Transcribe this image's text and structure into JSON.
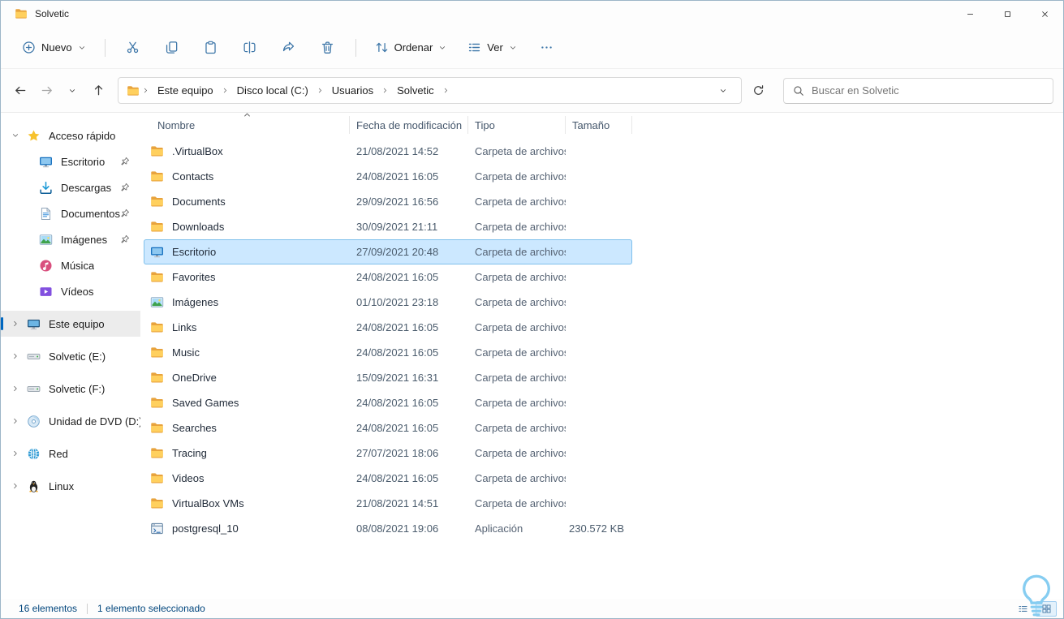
{
  "window": {
    "title": "Solvetic"
  },
  "theme": {
    "accent": "#0067c0",
    "selection_bg": "#cce8ff",
    "selection_border": "#7fc0ec",
    "status_text": "#00457c",
    "folder_color": "#ffd05e",
    "toolbar_icon_color": "#3d76a8"
  },
  "toolbar": {
    "new_label": "Nuevo",
    "sort_label": "Ordenar",
    "view_label": "Ver"
  },
  "navigation": {
    "breadcrumbs": [
      {
        "label": "Este equipo"
      },
      {
        "label": "Disco local (C:)"
      },
      {
        "label": "Usuarios"
      },
      {
        "label": "Solvetic"
      }
    ],
    "search_placeholder": "Buscar en Solvetic"
  },
  "sidebar": {
    "quick_access": {
      "label": "Acceso rápido",
      "icon": "star",
      "items": [
        {
          "label": "Escritorio",
          "icon": "desktop",
          "pinned": true
        },
        {
          "label": "Descargas",
          "icon": "download",
          "pinned": true
        },
        {
          "label": "Documentos",
          "icon": "document",
          "pinned": true
        },
        {
          "label": "Imágenes",
          "icon": "picture",
          "pinned": true
        },
        {
          "label": "Música",
          "icon": "music",
          "pinned": false
        },
        {
          "label": "Vídeos",
          "icon": "video",
          "pinned": false
        }
      ]
    },
    "tree": [
      {
        "label": "Este equipo",
        "icon": "computer",
        "selected": true
      },
      {
        "label": "Solvetic (E:)",
        "icon": "drive",
        "selected": false
      },
      {
        "label": "Solvetic (F:)",
        "icon": "drive",
        "selected": false
      },
      {
        "label": "Unidad de DVD (D:)",
        "icon": "dvd",
        "selected": false
      },
      {
        "label": "Red",
        "icon": "network",
        "selected": false
      },
      {
        "label": "Linux",
        "icon": "linux",
        "selected": false
      }
    ]
  },
  "file_list": {
    "columns": [
      {
        "label": "Nombre",
        "sorted": "asc"
      },
      {
        "label": "Fecha de modificación"
      },
      {
        "label": "Tipo"
      },
      {
        "label": "Tamaño"
      }
    ],
    "rows": [
      {
        "name": ".VirtualBox",
        "modified": "21/08/2021 14:52",
        "type": "Carpeta de archivos",
        "size": "",
        "icon": "folder",
        "selected": false
      },
      {
        "name": "Contacts",
        "modified": "24/08/2021 16:05",
        "type": "Carpeta de archivos",
        "size": "",
        "icon": "folder",
        "selected": false
      },
      {
        "name": "Documents",
        "modified": "29/09/2021 16:56",
        "type": "Carpeta de archivos",
        "size": "",
        "icon": "folder",
        "selected": false
      },
      {
        "name": "Downloads",
        "modified": "30/09/2021 21:11",
        "type": "Carpeta de archivos",
        "size": "",
        "icon": "folder",
        "selected": false
      },
      {
        "name": "Escritorio",
        "modified": "27/09/2021 20:48",
        "type": "Carpeta de archivos",
        "size": "",
        "icon": "desktop",
        "selected": true
      },
      {
        "name": "Favorites",
        "modified": "24/08/2021 16:05",
        "type": "Carpeta de archivos",
        "size": "",
        "icon": "folder",
        "selected": false
      },
      {
        "name": "Imágenes",
        "modified": "01/10/2021 23:18",
        "type": "Carpeta de archivos",
        "size": "",
        "icon": "picture",
        "selected": false
      },
      {
        "name": "Links",
        "modified": "24/08/2021 16:05",
        "type": "Carpeta de archivos",
        "size": "",
        "icon": "folder",
        "selected": false
      },
      {
        "name": "Music",
        "modified": "24/08/2021 16:05",
        "type": "Carpeta de archivos",
        "size": "",
        "icon": "folder",
        "selected": false
      },
      {
        "name": "OneDrive",
        "modified": "15/09/2021 16:31",
        "type": "Carpeta de archivos",
        "size": "",
        "icon": "folder",
        "selected": false
      },
      {
        "name": "Saved Games",
        "modified": "24/08/2021 16:05",
        "type": "Carpeta de archivos",
        "size": "",
        "icon": "folder",
        "selected": false
      },
      {
        "name": "Searches",
        "modified": "24/08/2021 16:05",
        "type": "Carpeta de archivos",
        "size": "",
        "icon": "folder",
        "selected": false
      },
      {
        "name": "Tracing",
        "modified": "27/07/2021 18:06",
        "type": "Carpeta de archivos",
        "size": "",
        "icon": "folder",
        "selected": false
      },
      {
        "name": "Videos",
        "modified": "24/08/2021 16:05",
        "type": "Carpeta de archivos",
        "size": "",
        "icon": "folder",
        "selected": false
      },
      {
        "name": "VirtualBox VMs",
        "modified": "21/08/2021 14:51",
        "type": "Carpeta de archivos",
        "size": "",
        "icon": "folder",
        "selected": false
      },
      {
        "name": "postgresql_10",
        "modified": "08/08/2021 19:06",
        "type": "Aplicación",
        "size": "230.572 KB",
        "icon": "app",
        "selected": false
      }
    ]
  },
  "status_bar": {
    "items_count": "16 elementos",
    "selection_count": "1 elemento seleccionado"
  }
}
